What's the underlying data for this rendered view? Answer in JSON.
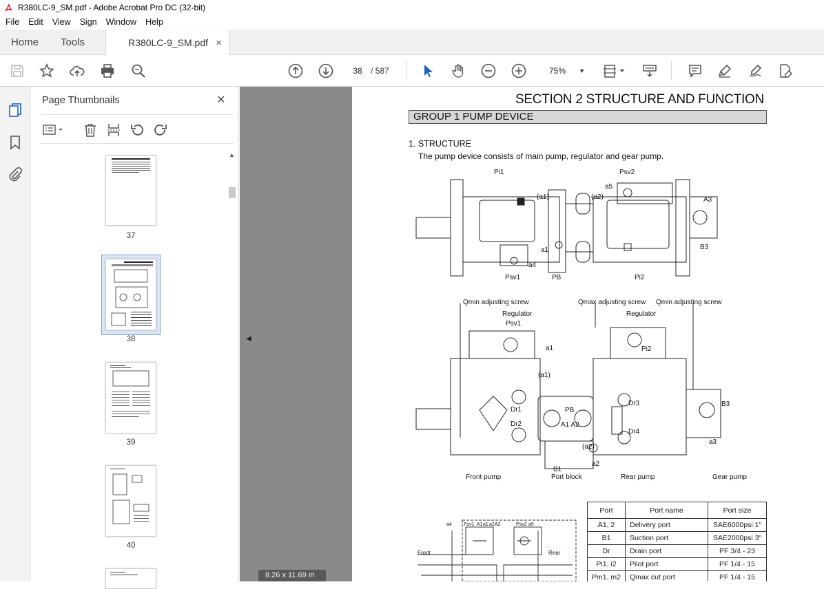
{
  "window": {
    "title": "R380LC-9_SM.pdf - Adobe Acrobat Pro DC (32-bit)"
  },
  "menu": [
    "File",
    "Edit",
    "View",
    "Sign",
    "Window",
    "Help"
  ],
  "tabs": {
    "home": "Home",
    "tools": "Tools",
    "document": "R380LC-9_SM.pdf",
    "close": "×"
  },
  "toolbar": {
    "page_current": "38",
    "page_total": "/ 587",
    "zoom": "75%"
  },
  "thumbnails": {
    "title": "Page Thumbnails",
    "close": "×",
    "pages": [
      {
        "num": "37"
      },
      {
        "num": "38",
        "selected": true
      },
      {
        "num": "39"
      },
      {
        "num": "40"
      }
    ]
  },
  "page_dims": "8.26 x 11.69 in",
  "document": {
    "section_title": "SECTION  2  STRUCTURE AND FUNCTION",
    "group_title": "GROUP  1  PUMP DEVICE",
    "structure_heading": "1. STRUCTURE",
    "structure_desc": "The pump device consists of main pump, regulator and gear pump.",
    "diagram1_labels": [
      "Pi1",
      "Psv2",
      "a5",
      "(a1)",
      "(a2)",
      "A3",
      "B3",
      "a1",
      "a4",
      "Psv1",
      "PB",
      "Pi2"
    ],
    "diagram2_labels": {
      "qmin_left": "Qmin adjusting screw",
      "qmax": "Qmax adjusting screw",
      "qmin_right": "Qmin adjusting screw",
      "regulator_left": "Regulator",
      "psv1": "Psv1",
      "regulator_right": "Regulator",
      "pi2": "Pi2",
      "a1": "a1",
      "a1p": "(a1)",
      "dr1": "Dr1",
      "dr2": "Dr2",
      "pb": "PB",
      "a1a2": "A1  A2",
      "dr3": "Dr3",
      "dr4": "Dr4",
      "b3": "B3",
      "a3": "a3",
      "a2p": "(a2)",
      "a2": "a2",
      "b1": "B1",
      "front_pump": "Front pump",
      "port_block": "Port block",
      "rear_pump": "Rear pump",
      "gear_pump": "Gear pump"
    },
    "diagram3_labels": [
      "a4",
      "Psv1",
      "A1",
      "a1",
      "a2",
      "A2",
      "Psv2",
      "a5",
      "Front",
      "Rear"
    ],
    "port_table": {
      "headers": [
        "Port",
        "Port name",
        "Port size"
      ],
      "rows": [
        [
          "A1, 2",
          "Delivery port",
          "SAE6000psi 1\""
        ],
        [
          "B1",
          "Suction port",
          "SAE2000psi 3\""
        ],
        [
          "Dr",
          "Drain port",
          "PF 3/4 - 23"
        ],
        [
          "Pi1, i2",
          "Pilot port",
          "PF 1/4 - 15"
        ],
        [
          "Pm1, m2",
          "Qmax cut port",
          "PF 1/4 - 15"
        ]
      ]
    }
  }
}
